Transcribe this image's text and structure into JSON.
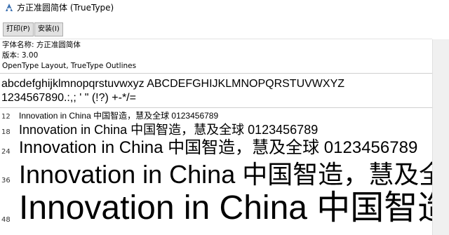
{
  "window": {
    "title": "方正准圆简体 (TrueType)",
    "icon": "font-viewer-icon"
  },
  "toolbar": {
    "print_label": "打印(P)",
    "install_label": "安装(I)"
  },
  "info": {
    "font_name": "字体名称: 方正准圆简体",
    "version": "版本: 3.00",
    "outline": "OpenType Layout, TrueType Outlines"
  },
  "samples": {
    "alphabet": "abcdefghijklmnopqrstuvwxyz ABCDEFGHIJKLMNOPQRSTUVWXYZ",
    "numbers": "1234567890.:,; ' \" (!?) +-*/="
  },
  "preview_rows": [
    {
      "size": "12",
      "text": "Innovation in China 中国智造，慧及全球 0123456789"
    },
    {
      "size": "18",
      "text": "Innovation in China 中国智造，慧及全球 0123456789"
    },
    {
      "size": "24",
      "text": "Innovation in China 中国智造，慧及全球 0123456789"
    },
    {
      "size": "36",
      "text": "Innovation in China 中国智造，慧及全球"
    },
    {
      "size": "48",
      "text": "Innovation in China 中国智造"
    }
  ]
}
